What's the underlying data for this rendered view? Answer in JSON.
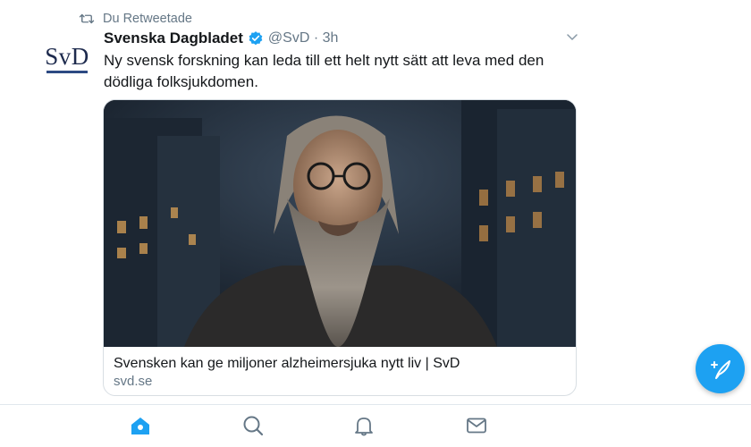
{
  "retweet": {
    "label": "Du Retweetade",
    "icon": "retweet-icon"
  },
  "tweet": {
    "avatar_text": "SvD",
    "display_name": "Svenska Dagbladet",
    "handle_time": "@SvD · 3h",
    "verified": true,
    "text": "Ny svensk forskning kan leda till ett helt nytt sätt att leva med den dödliga folksjukdomen.",
    "card": {
      "title": "Svensken kan ge miljoner alzheimersjuka nytt liv | SvD",
      "domain": "svd.se"
    }
  },
  "fab": {
    "icon": "compose-tweet-icon"
  },
  "tabbar": {
    "tabs": [
      {
        "name": "home",
        "icon": "home-icon",
        "active": true
      },
      {
        "name": "search",
        "icon": "search-icon",
        "active": false
      },
      {
        "name": "notifications",
        "icon": "bell-icon",
        "active": false
      },
      {
        "name": "messages",
        "icon": "mail-icon",
        "active": false
      }
    ]
  },
  "colors": {
    "accent": "#1da1f2",
    "secondary_text": "#657786",
    "primary_text": "#14171a",
    "border": "#e1e8ed"
  }
}
